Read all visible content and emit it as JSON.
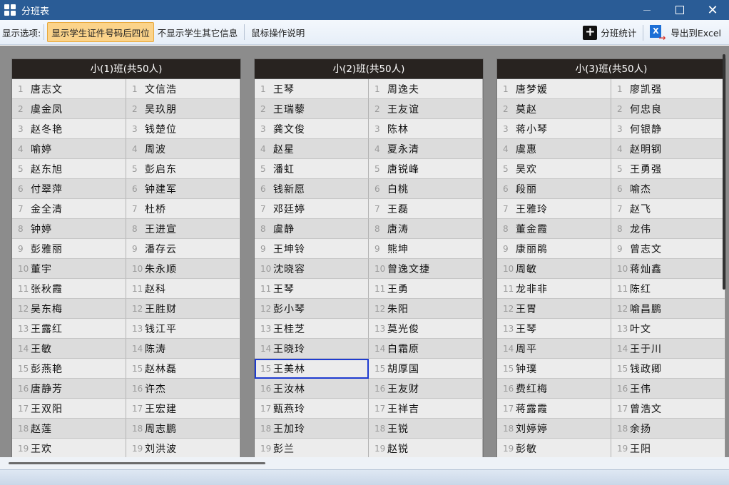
{
  "window": {
    "title": "分班表"
  },
  "toolbar": {
    "display_options_label": "显示选项:",
    "show_last4_label": "显示学生证件号码后四位",
    "hide_other_label": "不显示学生其它信息",
    "mouse_help_label": "鼠标操作说明",
    "stats_label": "分班统计",
    "export_label": "导出到Excel",
    "excel_glyph": "X"
  },
  "classes": [
    {
      "header": "小(1)班(共50人)",
      "rows": [
        [
          "1",
          "唐志文",
          "1",
          "文信浩"
        ],
        [
          "2",
          "虞金凤",
          "2",
          "吴玖朋"
        ],
        [
          "3",
          "赵冬艳",
          "3",
          "钱楚位"
        ],
        [
          "4",
          "喻婷",
          "4",
          "周波"
        ],
        [
          "5",
          "赵东旭",
          "5",
          "彭启东"
        ],
        [
          "6",
          "付翠萍",
          "6",
          "钟建军"
        ],
        [
          "7",
          "金全清",
          "7",
          "杜桥"
        ],
        [
          "8",
          "钟婷",
          "8",
          "王进宣"
        ],
        [
          "9",
          "彭雅丽",
          "9",
          "潘存云"
        ],
        [
          "10",
          "董宇",
          "10",
          "朱永顺"
        ],
        [
          "11",
          "张秋霞",
          "11",
          "赵科"
        ],
        [
          "12",
          "吴东梅",
          "12",
          "王胜财"
        ],
        [
          "13",
          "王露红",
          "13",
          "钱江平"
        ],
        [
          "14",
          "王敏",
          "14",
          "陈涛"
        ],
        [
          "15",
          "彭燕艳",
          "15",
          "赵林磊"
        ],
        [
          "16",
          "唐静芳",
          "16",
          "许杰"
        ],
        [
          "17",
          "王双阳",
          "17",
          "王宏建"
        ],
        [
          "18",
          "赵莲",
          "18",
          "周志鹏"
        ],
        [
          "19",
          "王欢",
          "19",
          "刘洪波"
        ]
      ]
    },
    {
      "header": "小(2)班(共50人)",
      "rows": [
        [
          "1",
          "王琴",
          "1",
          "周逸夫"
        ],
        [
          "2",
          "王瑞藜",
          "2",
          "王友谊"
        ],
        [
          "3",
          "龚文俊",
          "3",
          "陈林"
        ],
        [
          "4",
          "赵星",
          "4",
          "夏永清"
        ],
        [
          "5",
          "潘虹",
          "5",
          "唐锐峰"
        ],
        [
          "6",
          "钱新愿",
          "6",
          "白桃"
        ],
        [
          "7",
          "邓廷婷",
          "7",
          "王磊"
        ],
        [
          "8",
          "虞静",
          "8",
          "唐涛"
        ],
        [
          "9",
          "王坤铃",
          "9",
          "熊坤"
        ],
        [
          "10",
          "沈晓容",
          "10",
          "曾逸文捷"
        ],
        [
          "11",
          "王琴",
          "11",
          "王勇"
        ],
        [
          "12",
          "彭小琴",
          "12",
          "朱阳"
        ],
        [
          "13",
          "王桂芝",
          "13",
          "莫光俊"
        ],
        [
          "14",
          "王晓玲",
          "14",
          "白霜原"
        ],
        [
          "15",
          "王美林",
          "15",
          "胡厚国"
        ],
        [
          "16",
          "王汝林",
          "16",
          "王友财"
        ],
        [
          "17",
          "甄燕玲",
          "17",
          "王祥吉"
        ],
        [
          "18",
          "王加玲",
          "18",
          "王锐"
        ],
        [
          "19",
          "彭兰",
          "19",
          "赵锐"
        ]
      ]
    },
    {
      "header": "小(3)班(共50人)",
      "rows": [
        [
          "1",
          "唐梦媛",
          "1",
          "廖凯强"
        ],
        [
          "2",
          "莫赵",
          "2",
          "何忠良"
        ],
        [
          "3",
          "蒋小琴",
          "3",
          "何银静"
        ],
        [
          "4",
          "虞惠",
          "4",
          "赵明钢"
        ],
        [
          "5",
          "吴欢",
          "5",
          "王勇强"
        ],
        [
          "6",
          "段丽",
          "6",
          "喻杰"
        ],
        [
          "7",
          "王雅玲",
          "7",
          "赵飞"
        ],
        [
          "8",
          "董金霞",
          "8",
          "龙伟"
        ],
        [
          "9",
          "康丽鹃",
          "9",
          "曾志文"
        ],
        [
          "10",
          "周敏",
          "10",
          "蒋灿鑫"
        ],
        [
          "11",
          "龙非非",
          "11",
          "陈红"
        ],
        [
          "12",
          "王胃",
          "12",
          "喻昌鹏"
        ],
        [
          "13",
          "王琴",
          "13",
          "叶文"
        ],
        [
          "14",
          "周平",
          "14",
          "王于川"
        ],
        [
          "15",
          "钟璞",
          "15",
          "钱政卿"
        ],
        [
          "16",
          "费红梅",
          "16",
          "王伟"
        ],
        [
          "17",
          "蒋露霞",
          "17",
          "曾浩文"
        ],
        [
          "18",
          "刘婷婷",
          "18",
          "余扬"
        ],
        [
          "19",
          "彭敏",
          "19",
          "王阳"
        ]
      ]
    }
  ]
}
